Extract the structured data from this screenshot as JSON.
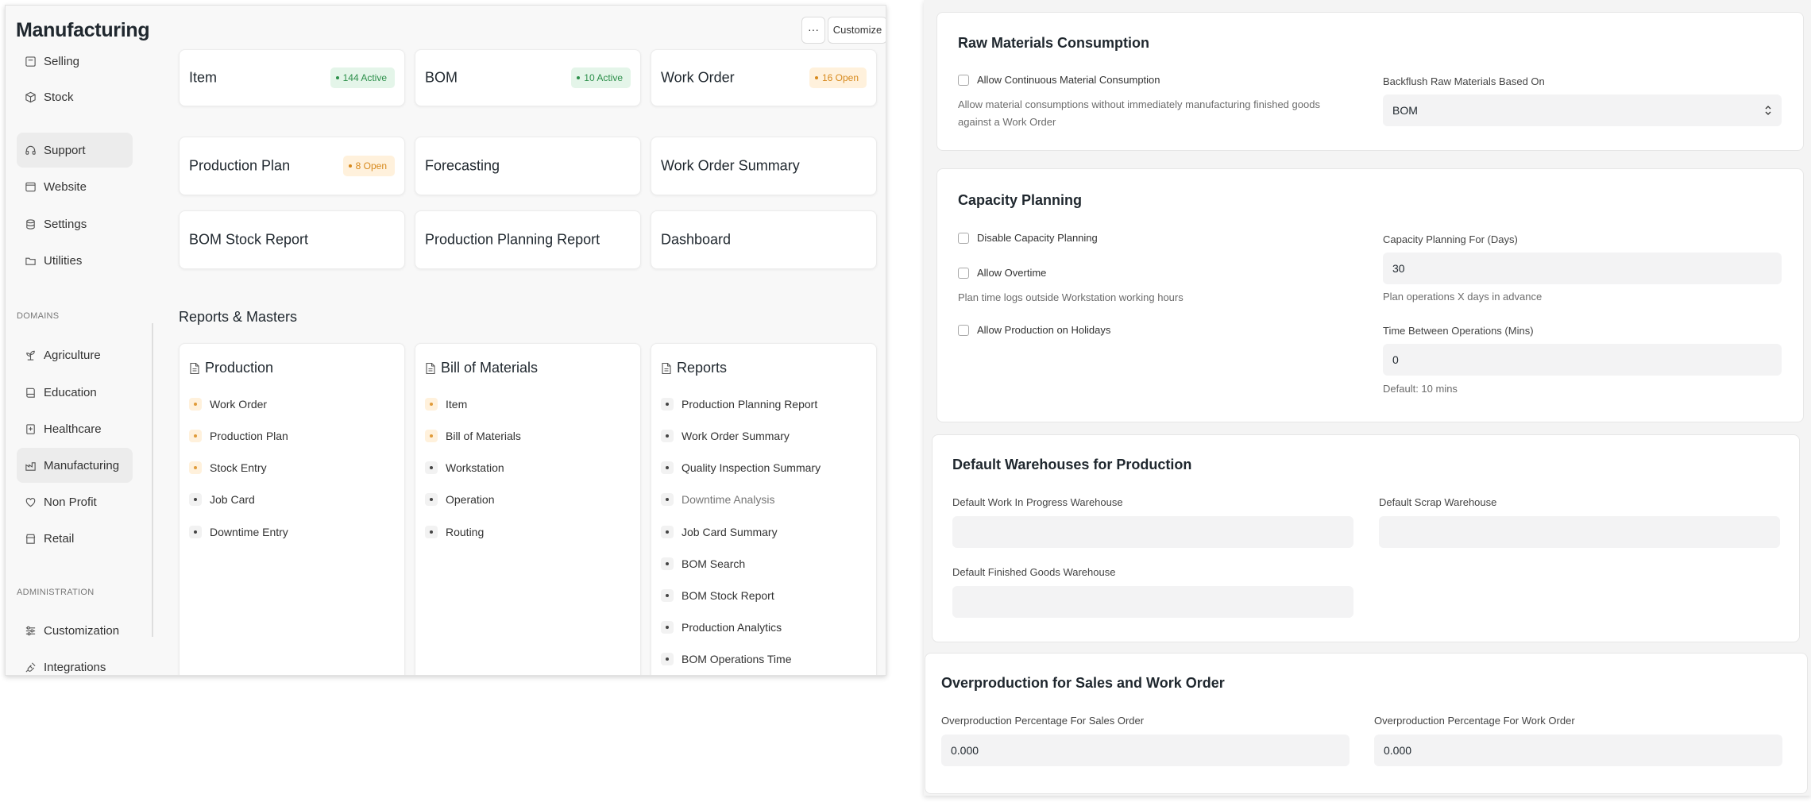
{
  "left": {
    "title": "Manufacturing",
    "header": {
      "more_label": "···",
      "customize_label": "Customize"
    },
    "sidebar": {
      "items_top": [
        {
          "label": "Selling",
          "icon": "receipt-icon"
        },
        {
          "label": "Stock",
          "icon": "cube-icon"
        },
        {
          "label": "Support",
          "icon": "headset-icon"
        },
        {
          "label": "Website",
          "icon": "browser-icon"
        },
        {
          "label": "Settings",
          "icon": "database-icon"
        },
        {
          "label": "Utilities",
          "icon": "folder-icon"
        }
      ],
      "section_domains": "DOMAINS",
      "items_domains": [
        {
          "label": "Agriculture",
          "icon": "plant-icon"
        },
        {
          "label": "Education",
          "icon": "book-icon"
        },
        {
          "label": "Healthcare",
          "icon": "hospital-icon"
        },
        {
          "label": "Manufacturing",
          "icon": "factory-icon"
        },
        {
          "label": "Non Profit",
          "icon": "heart-hand-icon"
        },
        {
          "label": "Retail",
          "icon": "store-icon"
        }
      ],
      "section_admin": "ADMINISTRATION",
      "items_admin": [
        {
          "label": "Customization",
          "icon": "sliders-icon"
        },
        {
          "label": "Integrations",
          "icon": "plug-icon"
        }
      ]
    },
    "shortcuts": [
      {
        "label": "Item",
        "badge": "144 Active",
        "badge_color": "green"
      },
      {
        "label": "BOM",
        "badge": "10 Active",
        "badge_color": "green"
      },
      {
        "label": "Work Order",
        "badge": "16 Open",
        "badge_color": "orange"
      },
      {
        "label": "Production Plan",
        "badge": "8 Open",
        "badge_color": "orange"
      },
      {
        "label": "Forecasting",
        "badge": "",
        "badge_color": ""
      },
      {
        "label": "Work Order Summary",
        "badge": "",
        "badge_color": ""
      },
      {
        "label": "BOM Stock Report",
        "badge": "",
        "badge_color": ""
      },
      {
        "label": "Production Planning Report",
        "badge": "",
        "badge_color": ""
      },
      {
        "label": "Dashboard",
        "badge": "",
        "badge_color": ""
      }
    ],
    "reports_heading": "Reports & Masters",
    "report_cards": [
      {
        "title": "Production",
        "links": [
          "Work Order",
          "Production Plan",
          "Stock Entry",
          "Job Card",
          "Downtime Entry"
        ]
      },
      {
        "title": "Bill of Materials",
        "links": [
          "Item",
          "Bill of Materials",
          "Workstation",
          "Operation",
          "Routing"
        ]
      },
      {
        "title": "Reports",
        "links": [
          "Production Planning Report",
          "Work Order Summary",
          "Quality Inspection Summary",
          "Downtime Analysis",
          "Job Card Summary",
          "BOM Search",
          "BOM Stock Report",
          "Production Analytics",
          "BOM Operations Time"
        ]
      }
    ]
  },
  "right": {
    "raw": {
      "title": "Raw Materials Consumption",
      "allow_continuous_label": "Allow Continuous Material Consumption",
      "allow_continuous_desc_1": "Allow material consumptions without immediately manufacturing finished goods",
      "allow_continuous_desc_2": "against a Work Order",
      "backflush_label": "Backflush Raw Materials Based On",
      "backflush_value": "BOM"
    },
    "capacity": {
      "title": "Capacity Planning",
      "disable_label": "Disable Capacity Planning",
      "overtime_label": "Allow Overtime",
      "overtime_desc": "Plan time logs outside Workstation working hours",
      "holidays_label": "Allow Production on Holidays",
      "days_label": "Capacity Planning For (Days)",
      "days_value": "30",
      "days_desc": "Plan operations X days in advance",
      "between_label": "Time Between Operations (Mins)",
      "between_value": "0",
      "between_desc": "Default: 10 mins"
    },
    "warehouses": {
      "title": "Default Warehouses for Production",
      "wip_label": "Default Work In Progress Warehouse",
      "scrap_label": "Default Scrap Warehouse",
      "fg_label": "Default Finished Goods Warehouse"
    },
    "overproduction": {
      "title": "Overproduction for Sales and Work Order",
      "so_label": "Overproduction Percentage For Sales Order",
      "so_value": "0.000",
      "wo_label": "Overproduction Percentage For Work Order",
      "wo_value": "0.000"
    }
  }
}
